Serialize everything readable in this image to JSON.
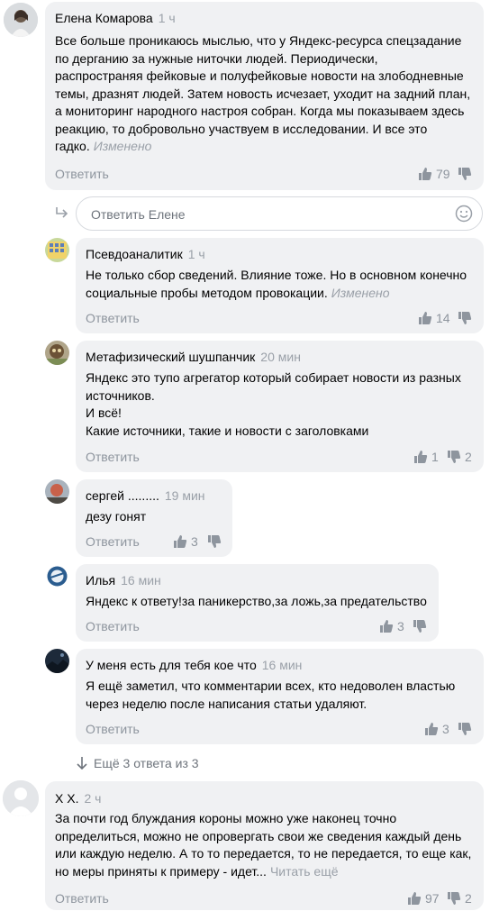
{
  "comments": [
    {
      "author": "Елена Комарова",
      "time": "1 ч",
      "lines": [
        "Все больше проникаюсь мыслью, что у Яндекс-ресурса спецзадание",
        "по дерганию за нужные ниточки людей. Периодически,",
        "распространяя фейковые и полуфейковые новости на злободневные",
        "темы, дразнят людей. Затем новость исчезает, уходит на задний план,",
        "а мониторинг народного настроя собран. Когда мы показываем здесь",
        "реакцию,  то добровольно участвуем в исследовании. И все это",
        "гадко."
      ],
      "edited": "Изменено",
      "reply": "Ответить",
      "likes": "79",
      "dislikes": ""
    },
    {
      "author": "Псевдоаналитик",
      "time": "1 ч",
      "lines": [
        "Не только сбор сведений. Влияние тоже. Но в основном конечно",
        "социальные пробы методом провокации."
      ],
      "edited": "Изменено",
      "reply": "Ответить",
      "likes": "14",
      "dislikes": ""
    },
    {
      "author": "Метафизический шушпанчик",
      "time": "20 мин",
      "lines": [
        "Яндекс это тупо агрегатор который собирает новости из разных",
        "источников.",
        "И всё!",
        "Какие источники, такие и новости с заголовками"
      ],
      "reply": "Ответить",
      "likes": "1",
      "dislikes": "2"
    },
    {
      "author": "сергей .........",
      "time": "19 мин",
      "lines": [
        "дезу гонят"
      ],
      "reply": "Ответить",
      "likes": "3",
      "dislikes": ""
    },
    {
      "author": "Илья",
      "time": "16 мин",
      "lines": [
        "Яндекс к ответу!за паникерство,за ложь,за предательство"
      ],
      "reply": "Ответить",
      "likes": "3",
      "dislikes": ""
    },
    {
      "author": "У меня есть для тебя кое что",
      "time": "16 мин",
      "lines": [
        "Я ещё заметил, что комментарии всех, кто недоволен властью",
        "через неделю после написания статьи удаляют."
      ],
      "reply": "Ответить",
      "likes": "3",
      "dislikes": ""
    },
    {
      "author": "Х Х.",
      "time": "2 ч",
      "lines": [
        "За почти год блуждания короны можно уже наконец точно",
        "определиться, можно не опровергать свои же сведения каждый день",
        "или каждую неделю. А то то передается, то не передается, то еще как,",
        "но меры приняты к примеру - идет..."
      ],
      "read_more": "Читать ещё",
      "reply": "Ответить",
      "likes": "97",
      "dislikes": "2"
    }
  ],
  "reply_input": {
    "placeholder": "Ответить Елене"
  },
  "more_replies": "Ещё 3 ответа из 3",
  "colors": {
    "bubble": "#f0f1f3",
    "muted": "#8e959e",
    "border": "#d6d9de"
  }
}
